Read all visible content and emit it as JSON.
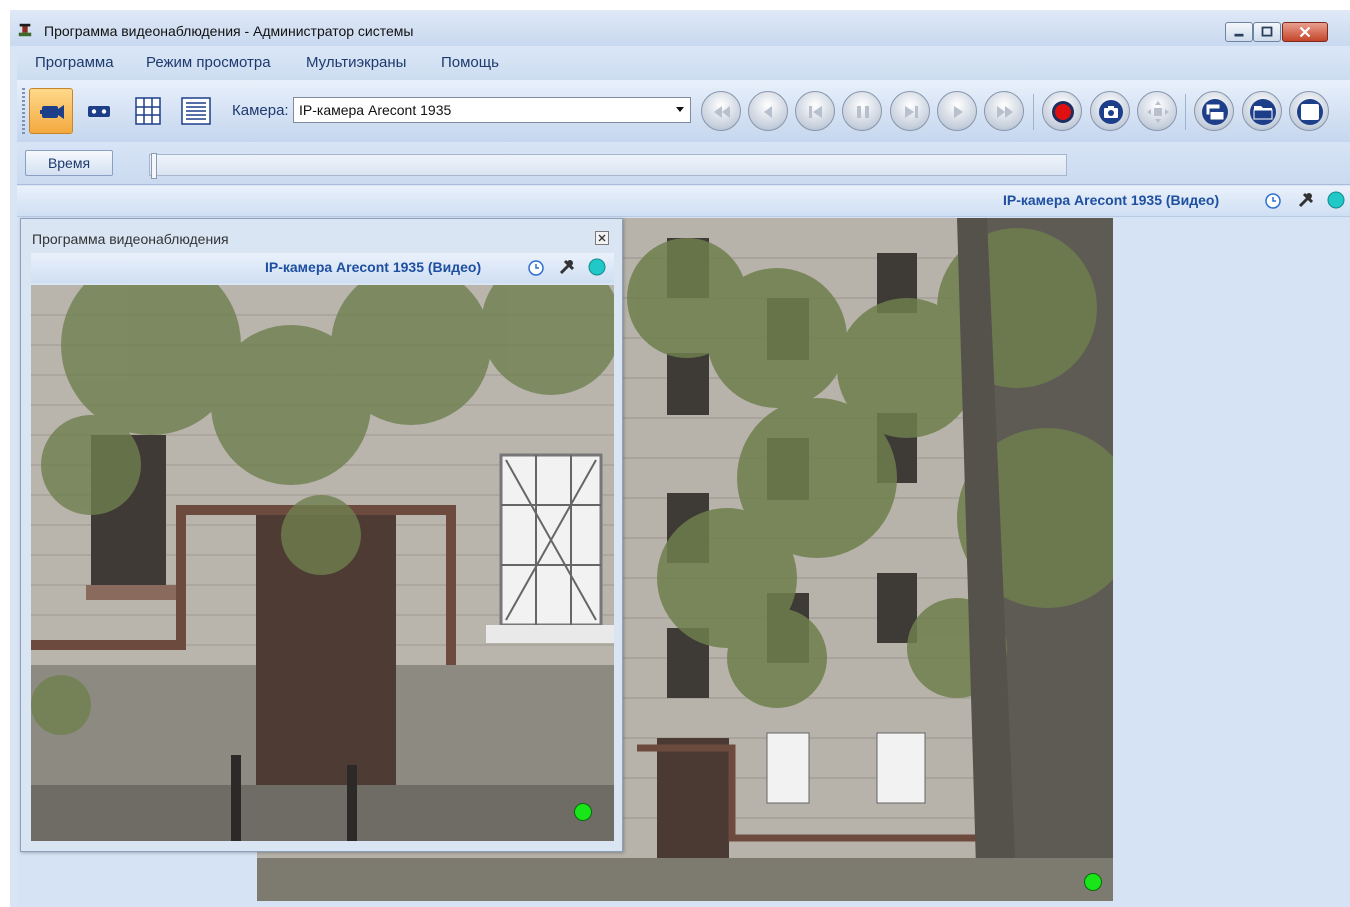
{
  "window": {
    "title": "Программа видеонаблюдения - Администратор системы"
  },
  "menu": {
    "items": [
      "Программа",
      "Режим просмотра",
      "Мультиэкраны",
      "Помощь"
    ]
  },
  "toolbar": {
    "camera_label": "Камера:",
    "camera_value": "IP-камера Arecont 1935",
    "buttons": [
      "live-view",
      "archive-view",
      "grid-layout",
      "list-layout",
      "rewind",
      "step-back",
      "to-start",
      "pause",
      "to-end",
      "play",
      "fast-forward",
      "record",
      "snapshot",
      "ptz",
      "windows",
      "folder",
      "fullscreen"
    ]
  },
  "timebar": {
    "time_button": "Время"
  },
  "main_view": {
    "camera_title": "IP-камера Arecont 1935 (Видео)",
    "status_color": "#19e619"
  },
  "float_window": {
    "title": "Программа видеонаблюдения",
    "camera_title": "IP-камера Arecont 1935 (Видео)"
  },
  "colors": {
    "accent": "#1e4fa0",
    "record": "#e01010",
    "active_button": "#f3a93e",
    "teal_indicator": "#20c8c8"
  }
}
